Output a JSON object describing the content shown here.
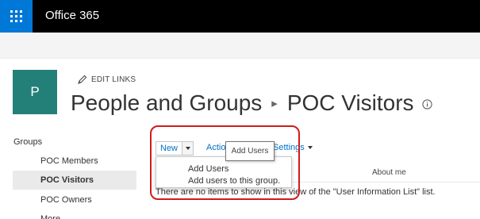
{
  "suite_bar": {
    "app_launcher_icon": "waffle-icon",
    "title": "Office 365",
    "colors": {
      "bar": "#000000",
      "launcher": "#0078d7"
    }
  },
  "site": {
    "logo_letter": "P",
    "logo_color": "#238079",
    "edit_links": "EDIT LINKS",
    "title_parts": [
      "People and Groups",
      "POC Visitors"
    ],
    "breadcrumb_separator": "▸"
  },
  "leftnav": {
    "heading": "Groups",
    "items": [
      {
        "label": "POC Members",
        "selected": false
      },
      {
        "label": "POC Visitors",
        "selected": true
      },
      {
        "label": "POC Owners",
        "selected": false
      },
      {
        "label": "More...",
        "selected": false
      }
    ]
  },
  "toolbar": {
    "new_label": "New",
    "actions_label": "Actions",
    "settings_label": "Settings",
    "tooltip": "Add Users"
  },
  "dropdown": {
    "item_title": "Add Users",
    "item_description": "Add users to this group."
  },
  "list": {
    "column_about": "About me",
    "empty_message": "There are no items to show in this view of the \"User Information List\" list."
  },
  "annotation": {
    "color": "#d11b1b"
  }
}
